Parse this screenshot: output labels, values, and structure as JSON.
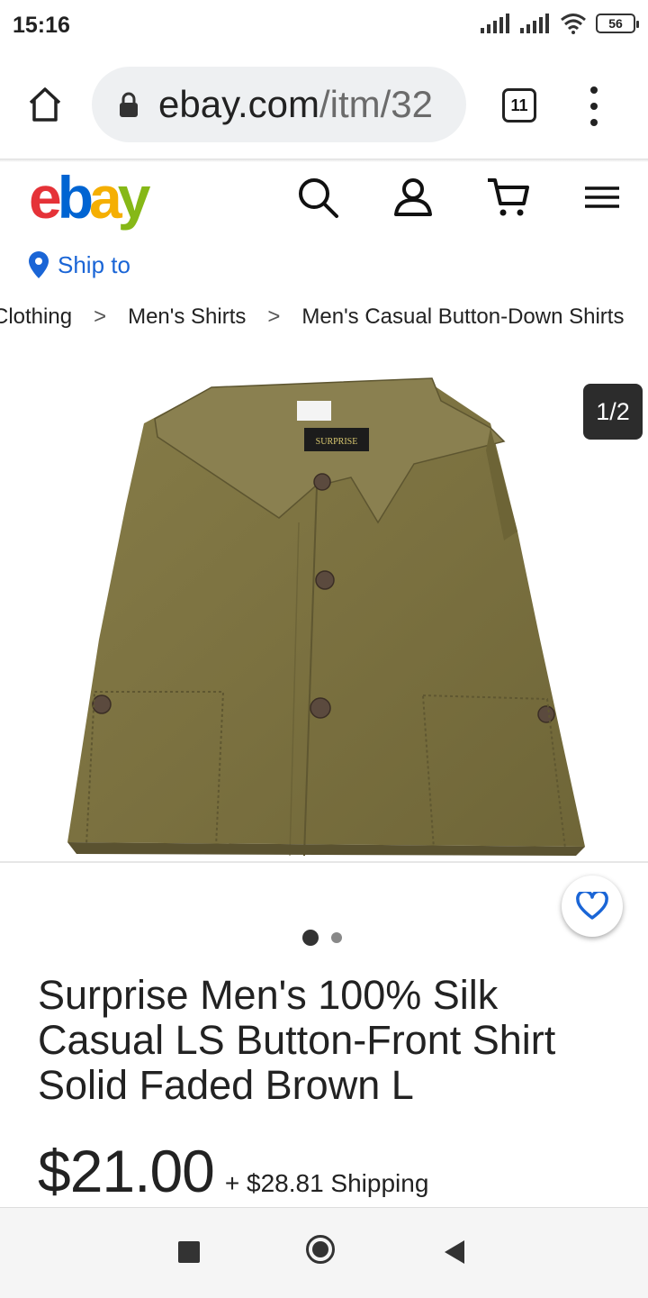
{
  "status_bar": {
    "time": "15:16",
    "battery": "56"
  },
  "browser": {
    "url_main": "ebay.com",
    "url_path": "/itm/32",
    "tab_count": "11"
  },
  "header": {
    "logo": {
      "e": "e",
      "b": "b",
      "a": "a",
      "y": "y"
    },
    "ship_to": "Ship to"
  },
  "breadcrumb": [
    "Clothing",
    "Men's Shirts",
    "Men's Casual Button-Down Shirts"
  ],
  "gallery": {
    "counter": "1/2",
    "total_dots": 2,
    "active_dot": 1
  },
  "product": {
    "title": "Surprise Men's 100% Silk Casual LS Button-Front Shirt Solid Faded Brown L",
    "price": "$21.00",
    "shipping": "+ $28.81 Shipping",
    "label_text": "SURPRISE"
  },
  "icons": [
    "home-icon",
    "lock-icon",
    "tabs-icon",
    "kebab-menu-icon",
    "search-icon",
    "account-icon",
    "cart-icon",
    "hamburger-menu-icon",
    "location-pin-icon",
    "heart-icon"
  ],
  "colors": {
    "ebay_red": "#e53238",
    "ebay_blue": "#0064d2",
    "ebay_yellow": "#f5af02",
    "ebay_green": "#86b817",
    "link_blue": "#1a65d6",
    "shirt_olive": "#7d7340"
  }
}
